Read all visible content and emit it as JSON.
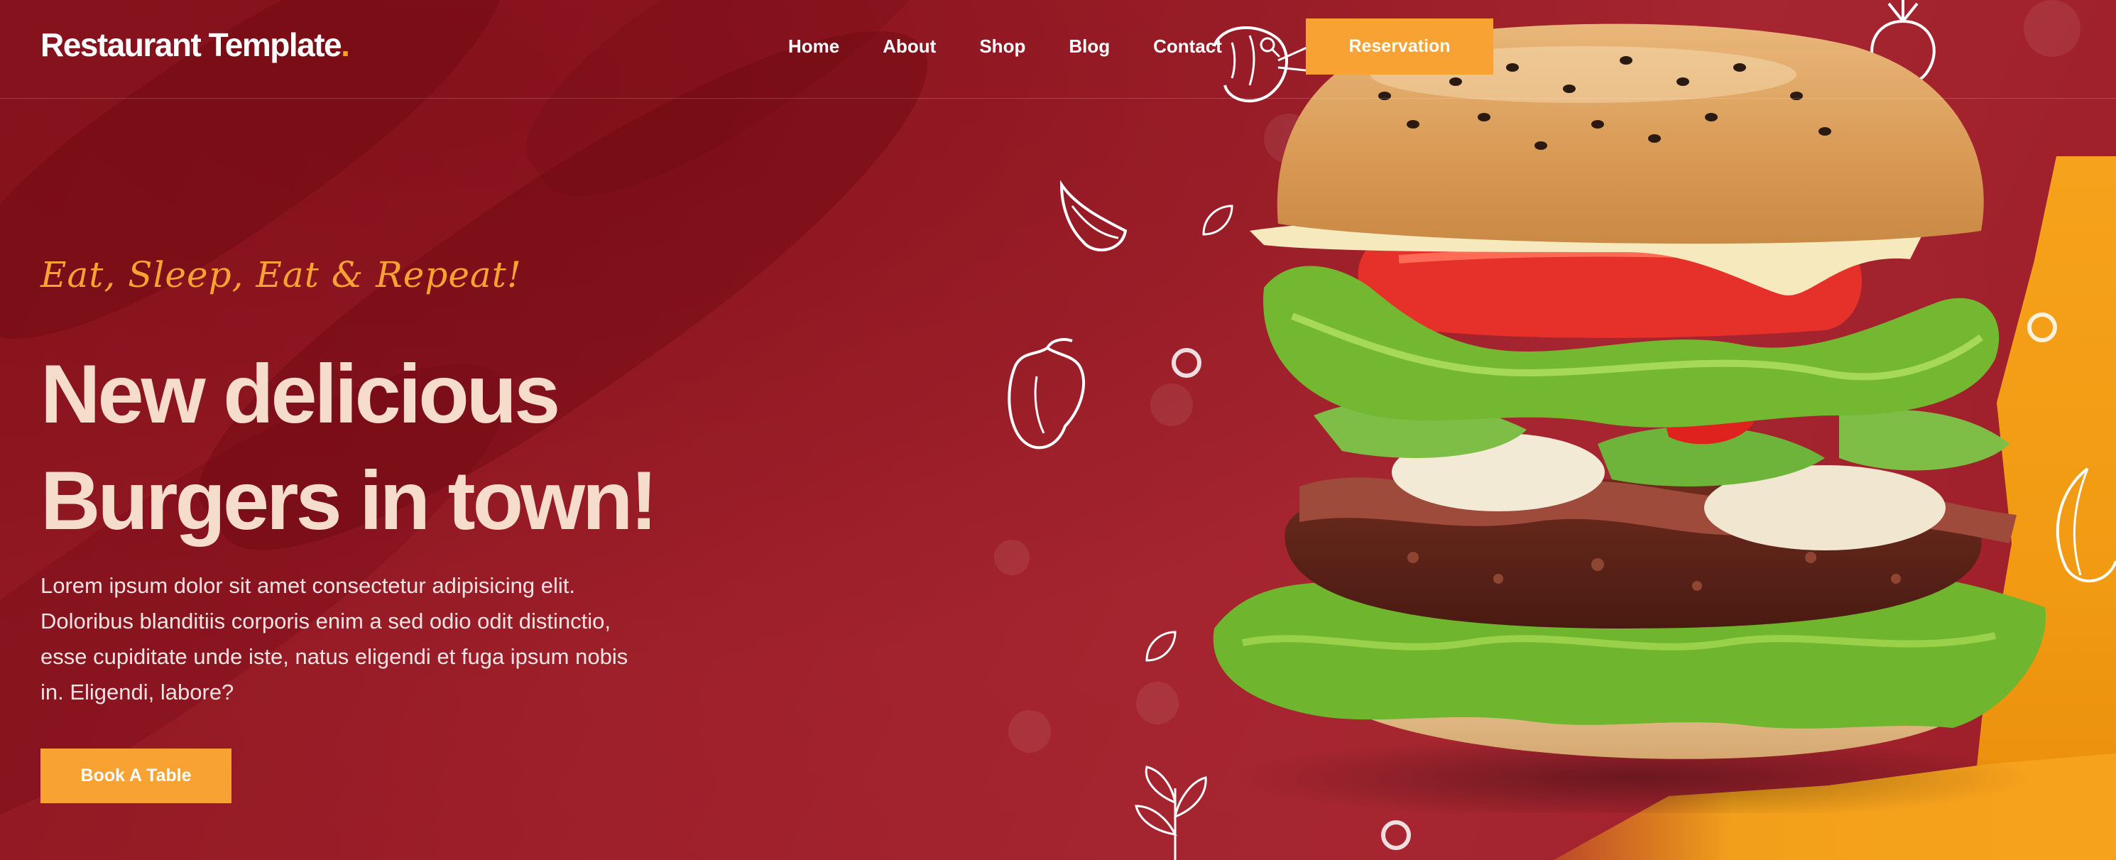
{
  "brand": {
    "name": "Restaurant Template",
    "dot": "."
  },
  "nav": {
    "items": [
      {
        "label": "Home"
      },
      {
        "label": "About"
      },
      {
        "label": "Shop"
      },
      {
        "label": "Blog"
      },
      {
        "label": "Contact"
      }
    ],
    "search_icon": "search-icon",
    "reservation_label": "Reservation"
  },
  "hero": {
    "tagline": "Eat, Sleep, Eat & Repeat!",
    "headline_line1": "New delicious",
    "headline_line2": "Burgers in town!",
    "description": "Lorem ipsum dolor sit amet consectetur adipisicing elit. Doloribus blanditiis corporis enim a sed odio odit distinctio, esse cupiditate unde iste, natus eligendi et fuga ipsum nobis in. Eligendi, labore?",
    "cta_label": "Book A Table"
  },
  "colors": {
    "background": "#9a1c26",
    "accent": "#f7a233",
    "headline": "#f5dccb",
    "text": "#ffffff"
  },
  "images": {
    "hero_image": "burger-image",
    "doodles": [
      "shrimp-doodle",
      "radish-doodle",
      "garlic-doodle",
      "pepper-doodle",
      "leaf-doodle",
      "herb-doodle",
      "onion-doodle"
    ]
  }
}
